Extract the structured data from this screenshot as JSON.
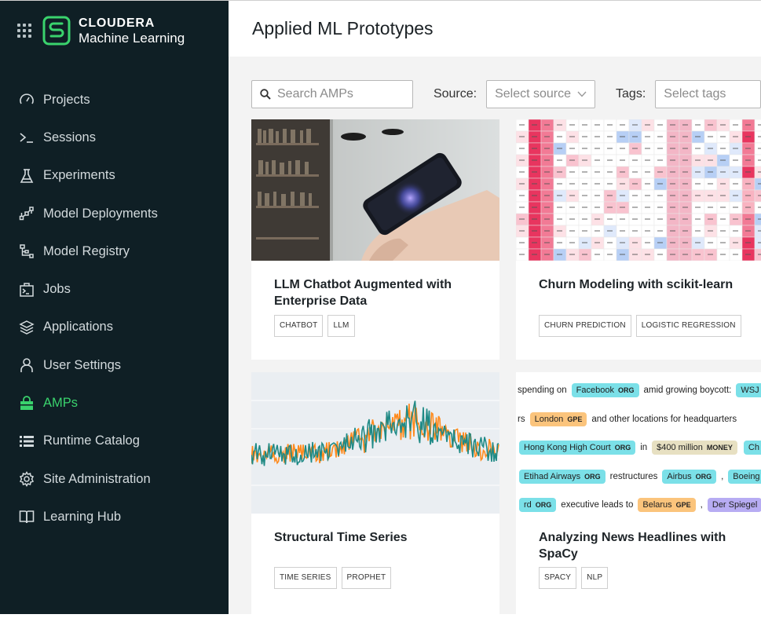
{
  "brand": {
    "name_top": "CLOUDERA",
    "name_bottom": "Machine Learning",
    "accent_color": "#3ad36d"
  },
  "sidebar": {
    "items": [
      {
        "label": "Projects",
        "icon": "gauge-icon",
        "active": false
      },
      {
        "label": "Sessions",
        "icon": "terminal-prompt-icon",
        "active": false
      },
      {
        "label": "Experiments",
        "icon": "flask-icon",
        "active": false
      },
      {
        "label": "Model Deployments",
        "icon": "network-nodes-icon",
        "active": false
      },
      {
        "label": "Model Registry",
        "icon": "hierarchy-icon",
        "active": false
      },
      {
        "label": "Jobs",
        "icon": "briefcase-terminal-icon",
        "active": false
      },
      {
        "label": "Applications",
        "icon": "layers-icon",
        "active": false
      },
      {
        "label": "User Settings",
        "icon": "user-icon",
        "active": false
      },
      {
        "label": "AMPs",
        "icon": "shopping-bag-icon",
        "active": true
      },
      {
        "label": "Runtime Catalog",
        "icon": "list-icon",
        "active": false
      },
      {
        "label": "Site Administration",
        "icon": "gear-icon",
        "active": false
      },
      {
        "label": "Learning Hub",
        "icon": "open-book-icon",
        "active": false
      }
    ]
  },
  "header": {
    "title": "Applied ML Prototypes"
  },
  "filters": {
    "search_placeholder": "Search AMPs",
    "source_label": "Source:",
    "source_placeholder": "Select source",
    "tags_label": "Tags:",
    "tags_placeholder": "Select tags"
  },
  "cards": [
    {
      "title": "LLM Chatbot Augmented with Enterprise Data",
      "tags": [
        "CHATBOT",
        "LLM"
      ],
      "image": "phone-in-library-photo"
    },
    {
      "title": "Churn Modeling with scikit-learn",
      "tags": [
        "CHURN PREDICTION",
        "LOGISTIC REGRESSION"
      ],
      "image": "churn-data-table-heatmap"
    },
    {
      "title": "Structural Time Series",
      "tags": [
        "TIME SERIES",
        "PROPHET"
      ],
      "image": "time-series-line-plot"
    },
    {
      "title": "Analyzing News Headlines with SpaCy",
      "tags": [
        "SPACY",
        "NLP"
      ],
      "image": "named-entity-highlights"
    }
  ],
  "ner_preview": {
    "lines": [
      [
        {
          "t": "spending on"
        },
        {
          "t": "Facebook",
          "l": "ORG",
          "c": "cyan"
        },
        {
          "t": "amid growing boycott:"
        },
        {
          "t": "WSJ",
          "c": "cyan"
        }
      ],
      [
        {
          "t": "rs"
        },
        {
          "t": "London",
          "l": "GPE",
          "c": "orange"
        },
        {
          "t": "and other locations for headquarters"
        }
      ],
      [
        {
          "t": "Hong Kong High Court",
          "l": "ORG",
          "c": "cyan"
        },
        {
          "t": "in"
        },
        {
          "t": "$400 million",
          "l": "MONEY",
          "c": "tan"
        },
        {
          "t": "Ch",
          "c": "cyan"
        }
      ],
      [
        {
          "t": "Etihad Airways",
          "l": "ORG",
          "c": "cyan"
        },
        {
          "t": "restructures"
        },
        {
          "t": "Airbus",
          "l": "ORG",
          "c": "cyan"
        },
        {
          "t": ","
        },
        {
          "t": "Boeing",
          "c": "cyan"
        }
      ],
      [
        {
          "t": "rd",
          "l": "ORG",
          "c": "cyan"
        },
        {
          "t": "executive leads to"
        },
        {
          "t": "Belarus",
          "l": "GPE",
          "c": "orange"
        },
        {
          "t": ","
        },
        {
          "t": "Der Spiegel",
          "c": "purple"
        }
      ]
    ]
  }
}
